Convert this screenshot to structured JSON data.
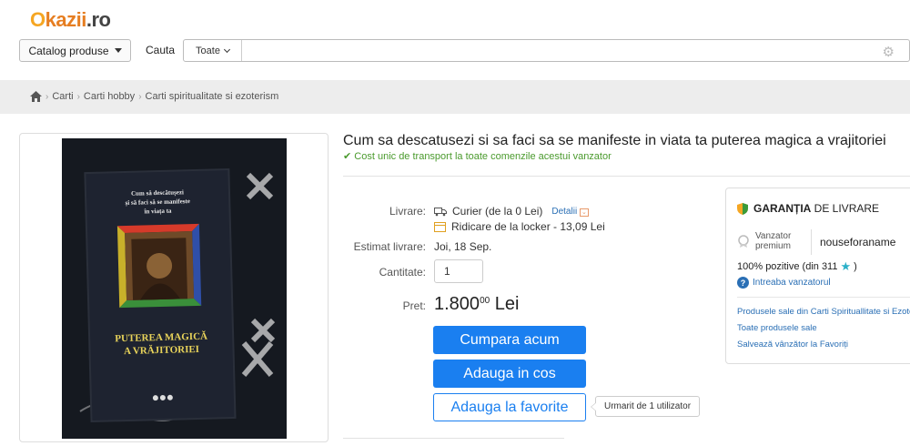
{
  "logo": {
    "o": "O",
    "mid": "kazii",
    "tld": ".ro"
  },
  "header": {
    "catalog_label": "Catalog produse",
    "search_label": "Cauta",
    "search_scope": "Toate",
    "search_placeholder": ""
  },
  "breadcrumb": [
    "Carti",
    "Carti hobby",
    "Carti spiritualitate si ezoterism"
  ],
  "book_cover": {
    "subtitle": "Cum să descătușezi și să faci să se manifeste în viața ta",
    "title_line1": "PUTEREA MAGICĂ",
    "title_line2": "A VRĂJITORIEI"
  },
  "product": {
    "title": "Cum sa descatusezi si sa faci sa se manifeste in viata ta puterea magica a vrajitoriei",
    "shipping_note": "Cost unic de transport la toate comenzile acestui vanzator",
    "livrare_label": "Livrare:",
    "courier": "Curier (de la 0 Lei)",
    "details_link": "Detalii",
    "locker": "Ridicare de la locker - 13,09 Lei",
    "estimate_label": "Estimat livrare:",
    "estimate_value": "Joi, 18 Sep.",
    "qty_label": "Cantitate:",
    "qty_value": "1",
    "price_label": "Pret:",
    "price_main": "1.800",
    "price_cents": "00",
    "currency": "Lei",
    "buy_now": "Cumpara acum",
    "add_cart": "Adauga in cos",
    "add_fav": "Adauga la favorite",
    "watchers": "Urmarit de 1 utilizator"
  },
  "seller": {
    "guarantee_bold": "GARANȚIA",
    "guarantee_rest": "DE LIVRARE",
    "premium_line1": "Vanzator",
    "premium_line2": "premium",
    "name": "nouseforaname",
    "positive": "100% pozitive (din 311",
    "positive_end": ")",
    "ask": "Intreaba vanzatorul",
    "link_category": "Produsele sale din Carti Spirituallitate si Ezoterism",
    "link_all": "Toate produsele sale",
    "link_save": "Salvează vânzător la Favoriți"
  },
  "colors": {
    "accent": "#1a7ff0",
    "green": "#4a9a2d",
    "logo_orange": "#e67e22"
  }
}
